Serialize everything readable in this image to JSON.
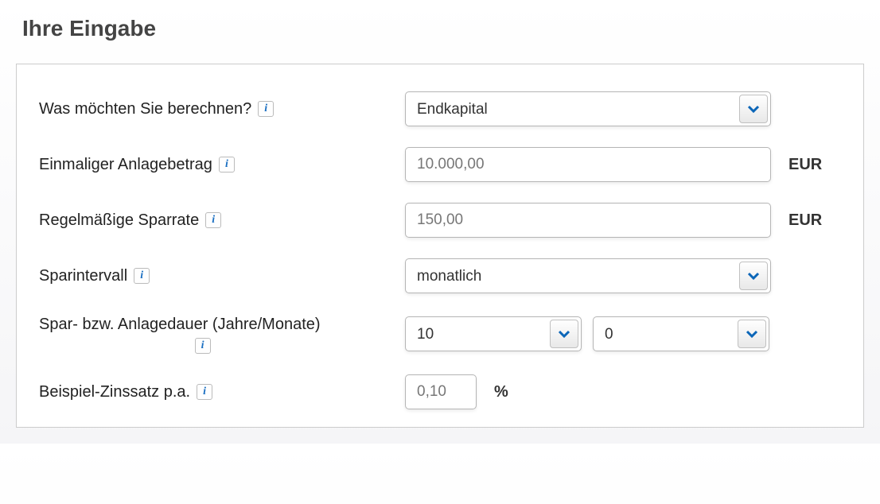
{
  "heading": "Ihre Eingabe",
  "fields": {
    "calculate": {
      "label": "Was möchten Sie berechnen?",
      "value": "Endkapital"
    },
    "initial": {
      "label": "Einmaliger Anlagebetrag",
      "value": "10.000,00",
      "unit": "EUR"
    },
    "rate": {
      "label": "Regelmäßige Sparrate",
      "value": "150,00",
      "unit": "EUR"
    },
    "interval": {
      "label": "Sparintervall",
      "value": "monatlich"
    },
    "duration": {
      "label": "Spar- bzw. Anlagedauer (Jahre/Monate)",
      "years": "10",
      "months": "0"
    },
    "interest": {
      "label": "Beispiel-Zinssatz p.a.",
      "value": "0,10",
      "unit": "%"
    }
  }
}
